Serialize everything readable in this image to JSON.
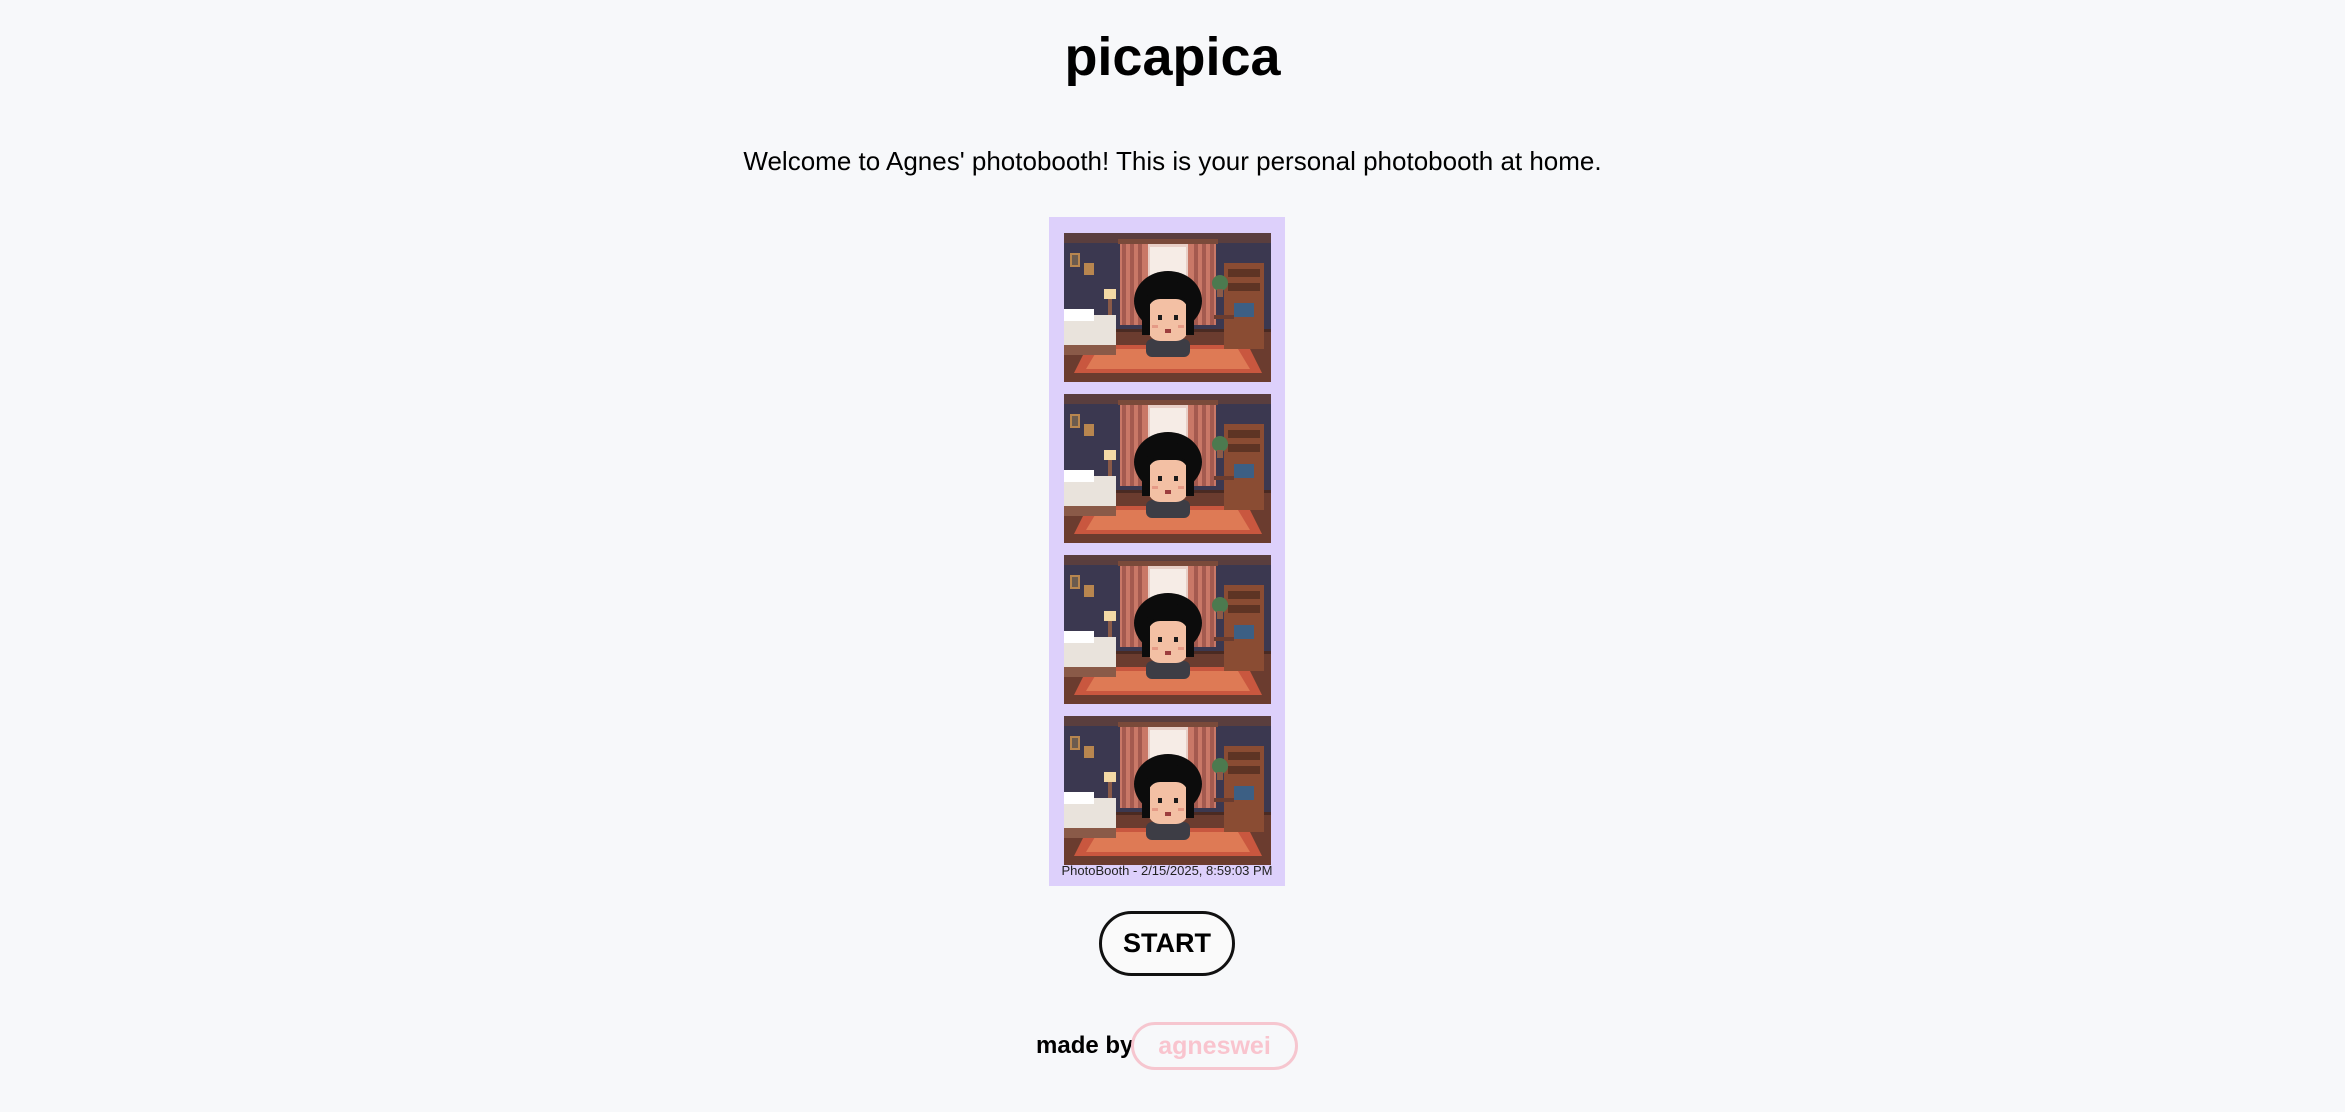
{
  "header": {
    "title": "picapica",
    "welcome": "Welcome to Agnes' photobooth! This is your personal photobooth at home."
  },
  "photo_strip": {
    "background_color": "#ddd0fb",
    "photos": [
      {
        "scene": "pixel-art bedroom with avatar, mouth open"
      },
      {
        "scene": "pixel-art bedroom with avatar, winking"
      },
      {
        "scene": "pixel-art bedroom with avatar, smiling"
      },
      {
        "scene": "pixel-art bedroom with avatar, big grin"
      }
    ],
    "caption": "PhotoBooth - 2/15/2025, 8:59:03 PM"
  },
  "actions": {
    "start_label": "START"
  },
  "footer": {
    "made_by": "made by",
    "author": "agneswei",
    "author_color": "#f9c4ce"
  }
}
